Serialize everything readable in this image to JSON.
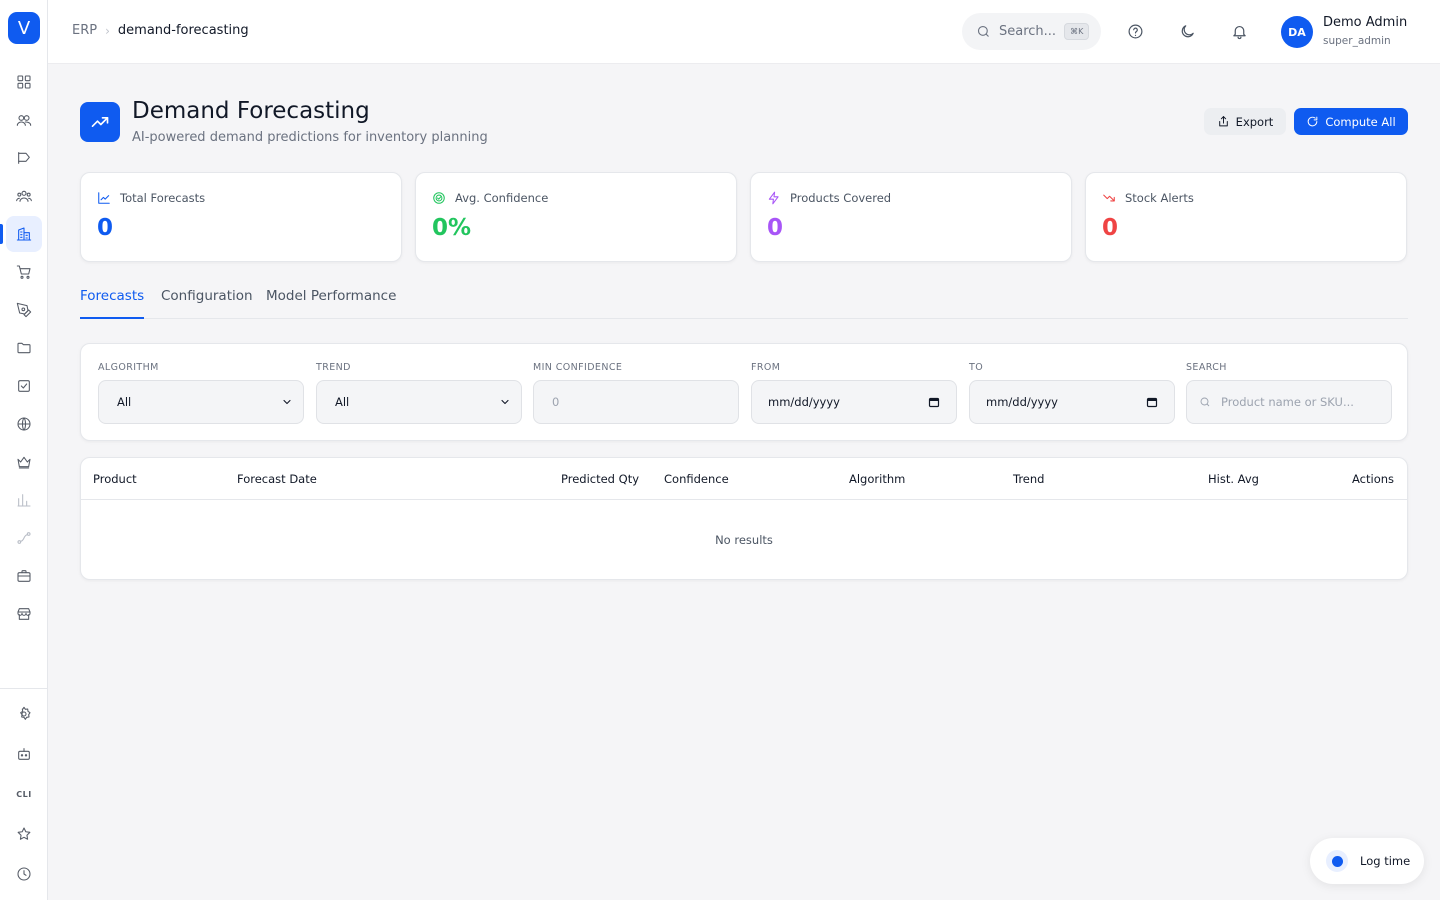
{
  "sidebar": {
    "logo": "V",
    "items": [
      {
        "icon": "grid-icon"
      },
      {
        "icon": "users-icon"
      },
      {
        "icon": "megaphone-icon"
      },
      {
        "icon": "team-icon"
      },
      {
        "icon": "building-icon",
        "active": true
      },
      {
        "icon": "cart-icon"
      },
      {
        "icon": "pen-tool-icon"
      },
      {
        "icon": "folder-icon"
      },
      {
        "icon": "checkbox-icon"
      },
      {
        "icon": "globe-icon"
      },
      {
        "icon": "crown-icon"
      },
      {
        "icon": "bar-chart-icon"
      },
      {
        "icon": "route-icon"
      },
      {
        "icon": "briefcase-icon"
      },
      {
        "icon": "store-icon"
      }
    ],
    "bottom_items": [
      {
        "icon": "settings-icon"
      },
      {
        "icon": "bot-icon"
      },
      {
        "label": "CLI"
      },
      {
        "icon": "star-icon"
      },
      {
        "icon": "clock-icon"
      }
    ],
    "accent": "#0f5bf0"
  },
  "header": {
    "breadcrumb_root": "ERP",
    "breadcrumb_current": "demand-forecasting",
    "search_label": "Search...",
    "search_shortcut": "⌘K",
    "user_initials": "DA",
    "user_name": "Demo Admin",
    "user_role": "super_admin"
  },
  "page": {
    "title": "Demand Forecasting",
    "subtitle": "AI-powered demand predictions for inventory planning",
    "export_label": "Export",
    "compute_label": "Compute All"
  },
  "stats": [
    {
      "label": "Total Forecasts",
      "value": "0",
      "color": "#0f5bf0",
      "icon": "trend-line-icon"
    },
    {
      "label": "Avg. Confidence",
      "value": "0%",
      "color": "#22c55e",
      "icon": "target-icon"
    },
    {
      "label": "Products Covered",
      "value": "0",
      "color": "#a855f7",
      "icon": "zap-icon"
    },
    {
      "label": "Stock Alerts",
      "value": "0",
      "color": "#ef4444",
      "icon": "trend-down-icon"
    }
  ],
  "tabs": [
    "Forecasts",
    "Configuration",
    "Model Performance"
  ],
  "filters": {
    "algorithm_label": "ALGORITHM",
    "algorithm_value": "All",
    "trend_label": "TREND",
    "trend_value": "All",
    "min_confidence_label": "MIN CONFIDENCE",
    "min_confidence_placeholder": "0",
    "from_label": "FROM",
    "from_placeholder": "mm/dd/yyyy",
    "to_label": "TO",
    "to_placeholder": "mm/dd/yyyy",
    "search_label": "SEARCH",
    "search_placeholder": "Product name or SKU..."
  },
  "table": {
    "columns": [
      "Product",
      "Forecast Date",
      "Predicted Qty",
      "Confidence",
      "Algorithm",
      "Trend",
      "Hist. Avg",
      "Actions"
    ],
    "empty_text": "No results"
  },
  "log_time_label": "Log time"
}
